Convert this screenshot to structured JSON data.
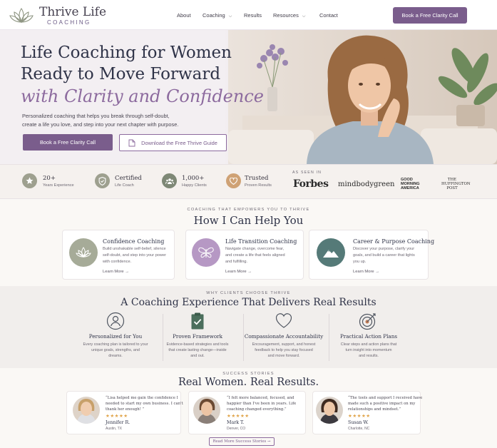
{
  "header": {
    "brand_name": "Thrive Life",
    "brand_sub": "COACHING",
    "nav": [
      "About",
      "Coaching",
      "Results",
      "Resources",
      "Contact"
    ],
    "cta": "Book a Free Clarity Call"
  },
  "hero": {
    "title_line1": "Life Coaching for Women",
    "title_line2": "Ready to Move Forward",
    "title_line3": "with Clarity and Confidence",
    "subtitle_line1": "Personalized coaching that helps you break through self-doubt,",
    "subtitle_line2": "create a life you love, and step into your next chapter with purpose.",
    "primary_cta": "Book a Free Clarity Call",
    "secondary_cta": "Download the Free Thrive Guide"
  },
  "stats": [
    {
      "icon": "star-icon",
      "value": "20+",
      "label": "Years Experience"
    },
    {
      "icon": "shield-check-icon",
      "value": "Certified",
      "label": "Life Coach"
    },
    {
      "icon": "people-icon",
      "value": "1,000+",
      "label": "Happy Clients"
    },
    {
      "icon": "heart-icon",
      "value": "Trusted",
      "label": "Proven Results"
    }
  ],
  "as_seen_in": {
    "label": "AS SEEN IN",
    "logos": [
      "Forbes",
      "mindbodygreen",
      "GOOD MORNING AMERICA",
      "THE HUFFINGTON POST"
    ]
  },
  "services": {
    "eyebrow": "COACHING THAT EMPOWERS YOU TO THRIVE",
    "title": "How I Can Help You",
    "cards": [
      {
        "icon": "lotus-icon",
        "title": "Confidence Coaching",
        "lines": [
          "Build unshakable self-belief, silence",
          "self-doubt, and step into your power",
          "with confidence."
        ],
        "link": "Learn More →",
        "color": "#a6ab98"
      },
      {
        "icon": "butterfly-icon",
        "title": "Life Transition Coaching",
        "lines": [
          "Navigate change, overcome fear,",
          "and create a life that feels aligned",
          "and fulfilling."
        ],
        "link": "Learn More →",
        "color": "#b698c4"
      },
      {
        "icon": "mountain-icon",
        "title": "Career & Purpose Coaching",
        "lines": [
          "Discover your purpose, clarify your",
          "goals, and build a career that lights",
          "you up."
        ],
        "link": "Learn More →",
        "color": "#557a78"
      }
    ]
  },
  "why": {
    "eyebrow": "WHY CLIENTS CHOOSE THRIVE",
    "title": "A Coaching Experience That Delivers Real Results",
    "items": [
      {
        "icon": "person-icon",
        "title": "Personalized for You",
        "lines": [
          "Every coaching plan is tailored to your",
          "unique goals, strengths, and",
          "dreams."
        ]
      },
      {
        "icon": "clipboard-check-icon",
        "title": "Proven Framework",
        "lines": [
          "Evidence-based strategies and tools",
          "that create lasting change—inside",
          "and out."
        ]
      },
      {
        "icon": "heart-outline-icon",
        "title": "Compassionate Accountability",
        "lines": [
          "Encouragement, support, and honest",
          "feedback to help you stay focused",
          "and move forward."
        ]
      },
      {
        "icon": "target-icon",
        "title": "Practical Action Plans",
        "lines": [
          "Clear steps and action plans that",
          "turn insight into momentum",
          "and results."
        ]
      }
    ]
  },
  "stories": {
    "eyebrow": "SUCCESS STORIES",
    "title": "Real Women. Real Results.",
    "testimonials": [
      {
        "quote_lines": [
          "“Lisa helped me gain the confidence I",
          "needed to start my own business. I can't",
          "thank her enough! ”"
        ],
        "stars": "★★★★★",
        "name": "Jennifer R.",
        "location": "Austin, TX"
      },
      {
        "quote_lines": [
          "“I felt more balanced, focused, and",
          "happier than I've been in years. Life",
          "coaching changed everything.”"
        ],
        "stars": "★★★★★",
        "name": "Mark T.",
        "location": "Denver, CO"
      },
      {
        "quote_lines": [
          "“The tools and support I received have",
          "made such a positive impact on my",
          "relationships and mindset.”"
        ],
        "stars": "★★★★★",
        "name": "Susan W.",
        "location": "Charlotte, NC"
      }
    ],
    "button": "Read More Success Stories →"
  },
  "colors": {
    "accent": "#7a5d8c",
    "accent_light": "#8c6a9e",
    "navy": "#2f3348",
    "star": "#e0a44a"
  }
}
